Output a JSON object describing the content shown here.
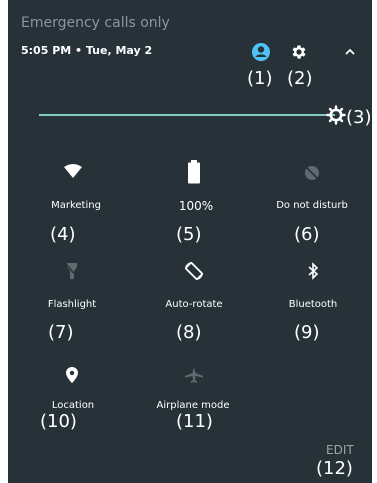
{
  "status_bar": {
    "text": "Emergency calls only"
  },
  "header": {
    "time_date": "5:05 PM  •  Tue, May 2"
  },
  "callouts": [
    "(1)",
    "(2)",
    "(3)",
    "(4)",
    "(5)",
    "(6)",
    "(7)",
    "(8)",
    "(9)",
    "(10)",
    "(11)",
    "(12)"
  ],
  "tiles": [
    {
      "label": "Marketing",
      "icon": "wifi-icon"
    },
    {
      "label": "100%",
      "icon": "battery-icon"
    },
    {
      "label": "Do not disturb",
      "icon": "do-not-disturb-icon"
    },
    {
      "label": "Flashlight",
      "icon": "flashlight-icon"
    },
    {
      "label": "Auto-rotate",
      "icon": "auto-rotate-icon"
    },
    {
      "label": "Bluetooth",
      "icon": "bluetooth-icon"
    },
    {
      "label": "Location",
      "icon": "location-icon"
    },
    {
      "label": "Airplane mode",
      "icon": "airplane-icon"
    }
  ],
  "footer": {
    "edit_label": "EDIT"
  },
  "brightness": {
    "level": 1.0
  },
  "colors": {
    "background": "#263238",
    "accent": "#80cbc4",
    "user_icon": "#4fc3f7",
    "muted": "#8a979d"
  }
}
